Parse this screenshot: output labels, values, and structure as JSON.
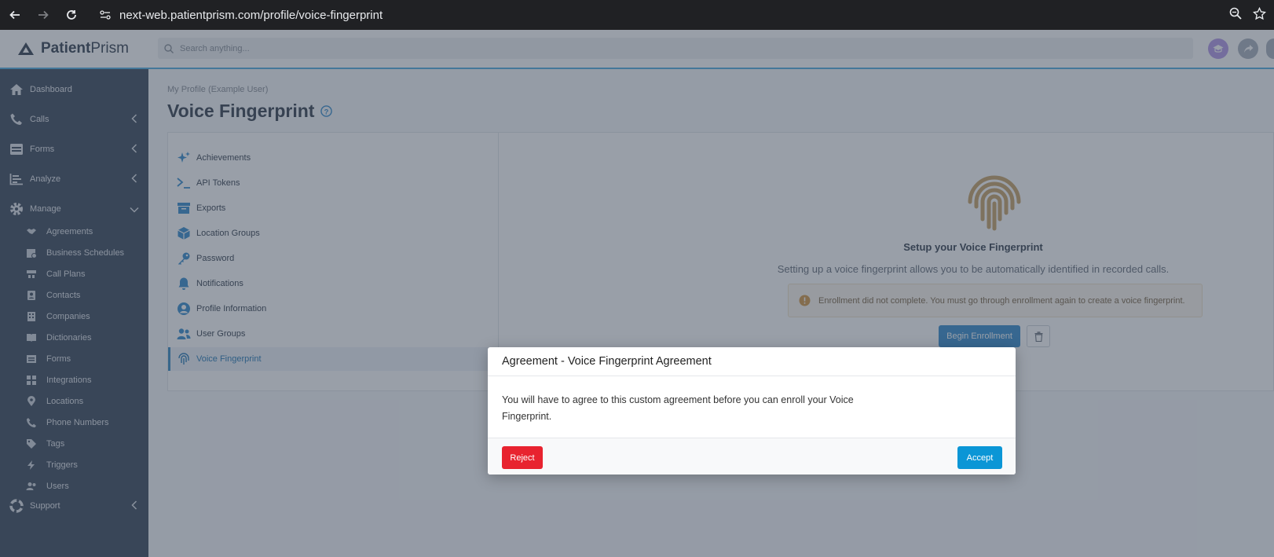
{
  "browser": {
    "url": "next-web.patientprism.com/profile/voice-fingerprint"
  },
  "header": {
    "logo_bold": "Patient",
    "logo_light": "Prism",
    "search_placeholder": "Search anything..."
  },
  "sidebar": {
    "items": [
      {
        "label": "Dashboard",
        "icon": "home-icon"
      },
      {
        "label": "Calls",
        "icon": "phone-icon"
      },
      {
        "label": "Forms",
        "icon": "forms-icon"
      },
      {
        "label": "Analyze",
        "icon": "analyze-icon"
      },
      {
        "label": "Manage",
        "icon": "gear-icon"
      }
    ],
    "manage_items": [
      {
        "label": "Agreements",
        "icon": "handshake-icon"
      },
      {
        "label": "Business Schedules",
        "icon": "calendar-icon"
      },
      {
        "label": "Call Plans",
        "icon": "call-plan-icon"
      },
      {
        "label": "Contacts",
        "icon": "contact-card-icon"
      },
      {
        "label": "Companies",
        "icon": "building-icon"
      },
      {
        "label": "Dictionaries",
        "icon": "book-icon"
      },
      {
        "label": "Forms",
        "icon": "form-icon"
      },
      {
        "label": "Integrations",
        "icon": "puzzle-icon"
      },
      {
        "label": "Locations",
        "icon": "map-pin-icon"
      },
      {
        "label": "Phone Numbers",
        "icon": "phone-number-icon"
      },
      {
        "label": "Tags",
        "icon": "tag-icon"
      },
      {
        "label": "Triggers",
        "icon": "bolt-icon"
      },
      {
        "label": "Users",
        "icon": "users-icon"
      }
    ],
    "support": {
      "label": "Support",
      "icon": "lifebuoy-icon"
    }
  },
  "main": {
    "breadcrumb": "My Profile (Example User)",
    "title": "Voice Fingerprint",
    "menu": [
      {
        "label": "Achievements",
        "icon": "sparkle-icon"
      },
      {
        "label": "API Tokens",
        "icon": "terminal-icon"
      },
      {
        "label": "Exports",
        "icon": "archive-icon"
      },
      {
        "label": "Location Groups",
        "icon": "cube-icon"
      },
      {
        "label": "Password",
        "icon": "key-icon"
      },
      {
        "label": "Notifications",
        "icon": "bell-icon"
      },
      {
        "label": "Profile Information",
        "icon": "profile-icon"
      },
      {
        "label": "User Groups",
        "icon": "user-group-icon"
      },
      {
        "label": "Voice Fingerprint",
        "icon": "fingerprint-icon",
        "active": true
      }
    ],
    "fingerprint": {
      "title": "Setup your Voice Fingerprint",
      "description": "Setting up a voice fingerprint allows you to be automatically identified in recorded calls.",
      "warning": "Enrollment did not complete. You must go through enrollment again to create a voice fingerprint.",
      "begin_label": "Begin Enrollment"
    }
  },
  "modal": {
    "title": "Agreement - Voice Fingerprint Agreement",
    "body": "You will have to agree to this custom agreement before you can enroll your Voice Fingerprint.",
    "reject_label": "Reject",
    "accept_label": "Accept"
  },
  "colors": {
    "sidebar": "#3f4c5e",
    "accent": "#3a8fce",
    "reject": "#e8232f",
    "accept": "#0b96d6"
  }
}
